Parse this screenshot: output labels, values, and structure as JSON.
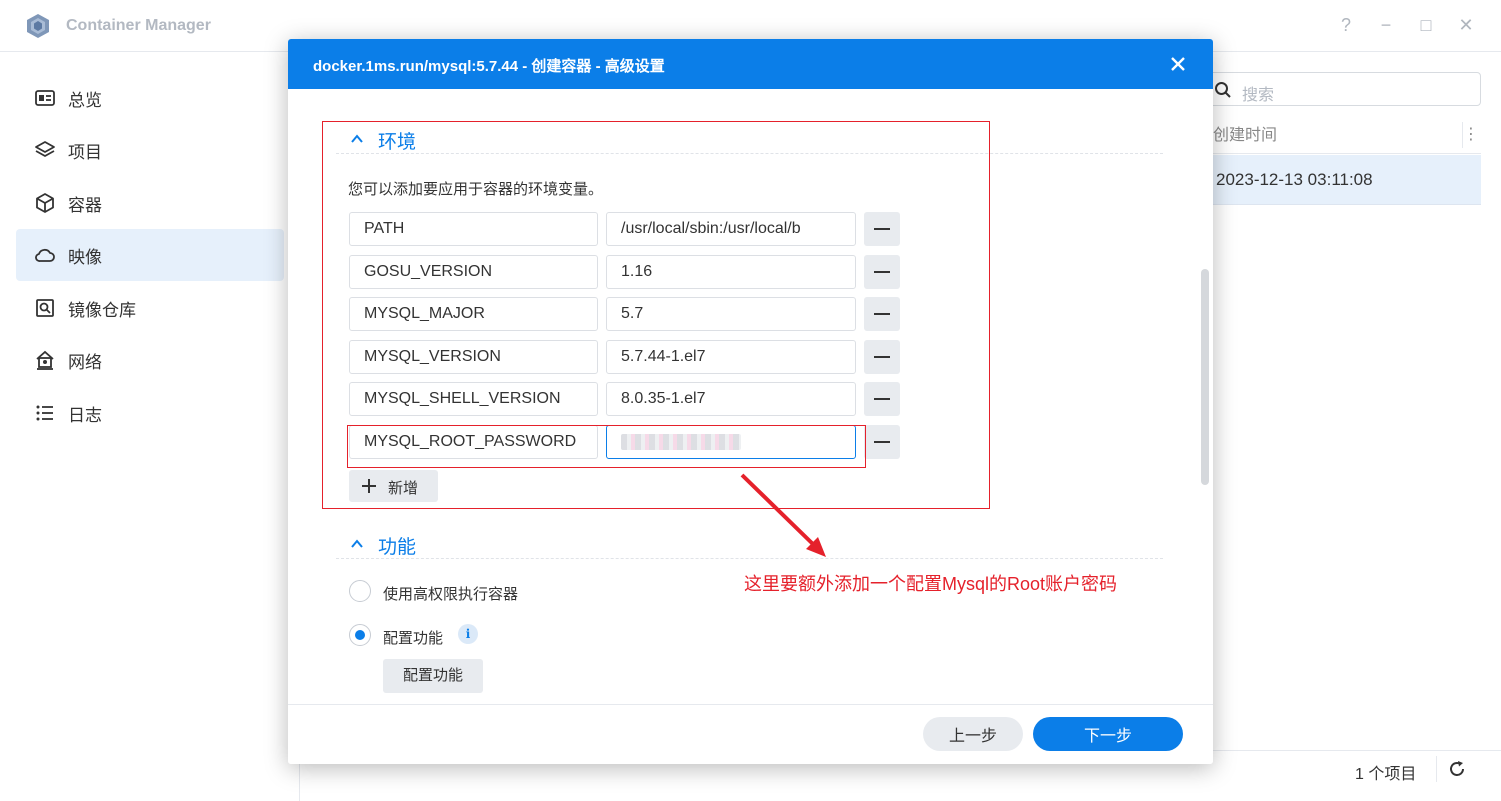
{
  "app": {
    "title": "Container Manager",
    "controls": [
      "?",
      "−",
      "□",
      "✕"
    ]
  },
  "sidebar": {
    "items": [
      {
        "label": "总览",
        "icon": "overview-icon"
      },
      {
        "label": "项目",
        "icon": "layers-icon"
      },
      {
        "label": "容器",
        "icon": "cube-icon"
      },
      {
        "label": "映像",
        "icon": "cloud-icon",
        "active": true
      },
      {
        "label": "镜像仓库",
        "icon": "registry-search-icon"
      },
      {
        "label": "网络",
        "icon": "network-home-icon"
      },
      {
        "label": "日志",
        "icon": "list-icon"
      }
    ]
  },
  "main": {
    "search_placeholder": "搜索",
    "column_header": "创建时间",
    "selected_row_created": "2023-12-13 03:11:08",
    "item_count": "1 个项目"
  },
  "modal": {
    "title": "docker.1ms.run/mysql:5.7.44 - 创建容器 - 高级设置",
    "env_section": {
      "heading": "环境",
      "description": "您可以添加要应用于容器的环境变量。",
      "variables": [
        {
          "key": "PATH",
          "value": "/usr/local/sbin:/usr/local/b"
        },
        {
          "key": "GOSU_VERSION",
          "value": "1.16"
        },
        {
          "key": "MYSQL_MAJOR",
          "value": "5.7"
        },
        {
          "key": "MYSQL_VERSION",
          "value": "5.7.44-1.el7"
        },
        {
          "key": "MYSQL_SHELL_VERSION",
          "value": "8.0.35-1.el7"
        },
        {
          "key": "MYSQL_ROOT_PASSWORD",
          "value": "",
          "blurred": true
        }
      ],
      "add_label": "新增"
    },
    "feature_section": {
      "heading": "功能",
      "privileged_label": "使用高权限执行容器",
      "privileged_checked": false,
      "capability_label": "配置功能",
      "capability_checked": true,
      "capability_button": "配置功能"
    },
    "footer": {
      "prev_label": "上一步",
      "next_label": "下一步"
    }
  },
  "annotation": {
    "text": "这里要额外添加一个配置Mysql的Root账户密码",
    "color": "#e5212b"
  },
  "colors": {
    "accent": "#0b7ee8",
    "active_nav": "#e6f0fb"
  }
}
